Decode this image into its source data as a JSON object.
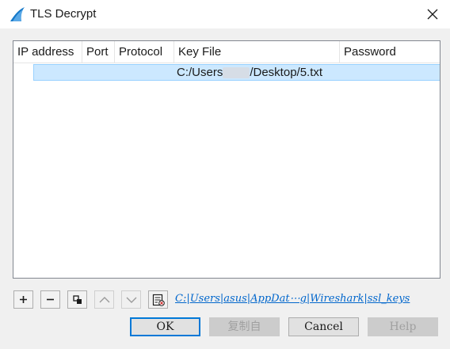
{
  "window": {
    "title": "TLS Decrypt"
  },
  "table": {
    "columns": [
      "IP address",
      "Port",
      "Protocol",
      "Key File",
      "Password"
    ],
    "rows": [
      {
        "ip": "",
        "port": "",
        "protocol": "",
        "key_file_prefix": "C:/Users",
        "key_file_suffix": "/Desktop/5.txt",
        "password": ""
      }
    ]
  },
  "toolbar": {
    "add_icon": "plus-icon",
    "remove_icon": "minus-icon",
    "copy_icon": "copy-icon",
    "up_icon": "chevron-up-icon",
    "down_icon": "chevron-down-icon",
    "clear_icon": "clear-list-icon",
    "keylog_link": "C:|Users|asus|AppDat⋯g|Wireshark|ssl_keys"
  },
  "buttons": {
    "ok": "OK",
    "copy_from": "复制自",
    "cancel": "Cancel",
    "help": "Help"
  },
  "colors": {
    "selection": "#cce8ff",
    "default_button_border": "#0078d7",
    "link": "#0066cc"
  }
}
